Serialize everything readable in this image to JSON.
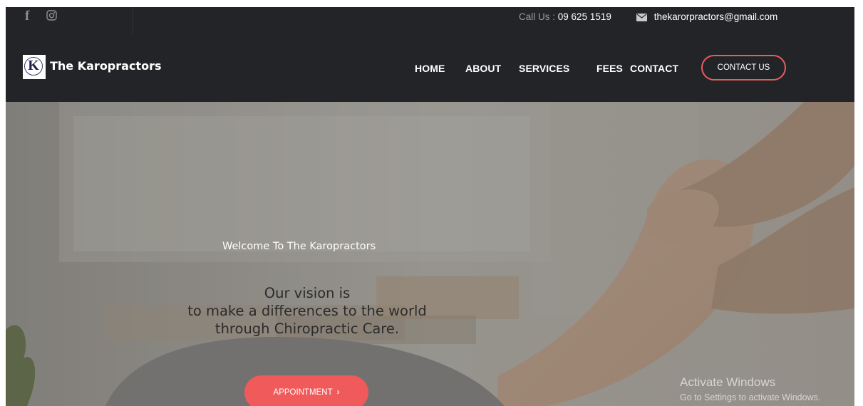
{
  "header": {
    "social": [
      {
        "icon": "facebook-icon"
      },
      {
        "icon": "instagram-icon"
      }
    ],
    "call_label": "Call Us :",
    "phone": "09 625 1519",
    "email_icon": "envelope-icon",
    "email": "thekarorpractors@gmail.com"
  },
  "nav": {
    "logo_letter": "K",
    "brand": "The Karopractors",
    "items": [
      "HOME",
      "ABOUT",
      "SERVICES",
      "FEES",
      "CONTACT"
    ],
    "cta": "CONTACT US"
  },
  "hero": {
    "welcome": "Welcome To The Karopractors",
    "vision_lines": [
      "Our vision is",
      "to make a differences to the world",
      "through Chiropractic Care."
    ],
    "button": "APPOINTMENT",
    "button_icon": "chevron-right-icon"
  },
  "watermark": {
    "title": "Activate Windows",
    "subtitle": "Go to Settings to activate Windows."
  },
  "colors": {
    "bar_bg": "#232427",
    "accent": "#f05a5b",
    "cta_border": "#e85d5d"
  }
}
